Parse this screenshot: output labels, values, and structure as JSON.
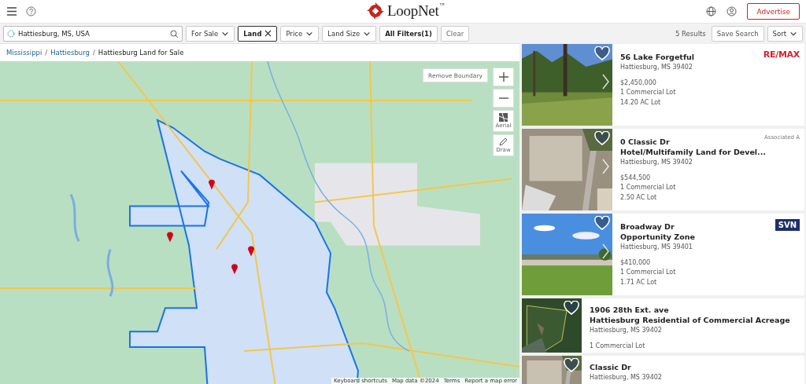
{
  "header": {
    "brand": "LoopNet",
    "trademark": "™",
    "advertise_button": "Advertise"
  },
  "search": {
    "value": "Hattiesburg, MS, USA"
  },
  "filters": [
    {
      "label": "For Sale",
      "kind": "dropdown"
    },
    {
      "label": "Land",
      "kind": "removable"
    },
    {
      "label": "Price",
      "kind": "dropdown"
    },
    {
      "label": "Land Size",
      "kind": "dropdown"
    },
    {
      "label": "All Filters(1)",
      "kind": "button"
    },
    {
      "label": "Clear",
      "kind": "plain"
    }
  ],
  "results_count": "5 Results",
  "save_search_button": "Save Search",
  "sort_button": "Sort",
  "breadcrumb": {
    "separator": "/",
    "items": [
      {
        "label": "Mississippi",
        "link": true
      },
      {
        "label": "Hattiesburg",
        "link": true
      },
      {
        "label": "Hattiesburg Land for Sale",
        "link": false
      }
    ]
  },
  "map": {
    "kind": "picture",
    "remove_boundary_button": "Remove Boundary",
    "aerial_label": "Aerial",
    "draw_label": "Draw",
    "footer_links": [
      "Keyboard shortcuts",
      "Map data ©2024",
      "Terms",
      "Report a map error"
    ]
  },
  "listings": [
    {
      "kind": "large",
      "title": [
        "56 Lake Forgetful"
      ],
      "address": "Hattiesburg, MS 39402",
      "price": "$2,450,000",
      "details": [
        "1 Commercial Lot",
        "14.20 AC Lot"
      ],
      "logo": {
        "kind": "remax",
        "text": "RE/MAX"
      }
    },
    {
      "kind": "large",
      "title": [
        "0 Classic Dr",
        "Hotel/Multifamily Land for Devel..."
      ],
      "address": "Hattiesburg, MS 39402",
      "price": "$544,500",
      "details": [
        "1 Commercial Lot",
        "2.50 AC Lot"
      ],
      "logo": {
        "kind": "text",
        "text": "Associated A"
      }
    },
    {
      "kind": "large",
      "title": [
        "Broadway Dr",
        "Opportunity Zone"
      ],
      "address": "Hattiesburg, MS 39401",
      "price": "$410,000",
      "details": [
        "1 Commercial Lot",
        "1.71 AC Lot"
      ],
      "logo": {
        "kind": "svn",
        "text": "SVN"
      }
    },
    {
      "kind": "small",
      "title": [
        "1906 28th Ext. ave",
        "Hattiesburg Residential of Commercial Acreage"
      ],
      "address": "Hattiesburg, MS 39402",
      "details": [
        "1 Commercial Lot"
      ]
    },
    {
      "kind": "small",
      "title": [
        "Classic Dr"
      ],
      "address": "Hattiesburg, MS 39402"
    }
  ]
}
